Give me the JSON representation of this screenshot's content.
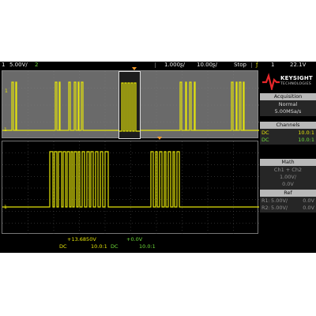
{
  "top_bar": {
    "ch1_number": "1",
    "ch1_scale": "5.00V/",
    "ch2_number": "2",
    "zoom_timebase": "1.000ʂ/",
    "main_timebase": "10.00ʂ/",
    "run_state": "Stop",
    "trigger_source": "1",
    "trigger_level": "22.1V"
  },
  "brand": {
    "name": "KEYSIGHT",
    "subtitle": "TECHNOLOGIES"
  },
  "acquisition": {
    "header": "Acquisition",
    "mode": "Normal",
    "rate": "5.00MSa/s"
  },
  "channels": {
    "header": "Channels",
    "rows": [
      {
        "coupling": "DC",
        "probe": "10.0:1"
      },
      {
        "coupling": "DC",
        "probe": "10.0:1"
      }
    ]
  },
  "math": {
    "header": "Math",
    "function": "Ch1 + Ch2",
    "scale": "1.00V/",
    "offset": "0.0V"
  },
  "ref": {
    "header": "Ref",
    "rows": [
      {
        "label": "R1:",
        "scale": "5.00V/",
        "offset": "0.0V"
      },
      {
        "label": "R2:",
        "scale": "5.00V/",
        "offset": "0.0V"
      }
    ]
  },
  "bottom_bar": {
    "ch1_offset": "+13.6850V",
    "ch2_offset": "+0.0V",
    "ch1_coupling": "DC",
    "ch1_probe": "10.0:1",
    "ch2_coupling": "DC",
    "ch2_probe": "10.0:1"
  },
  "markers": {
    "ch1_label": "1",
    "trigger_marker": "T"
  },
  "colors": {
    "ch1": "#e4e40a",
    "ch2": "#6fdc3a",
    "overview_bg": "#6a6a6a",
    "panel_header": "#b9b9b9"
  }
}
